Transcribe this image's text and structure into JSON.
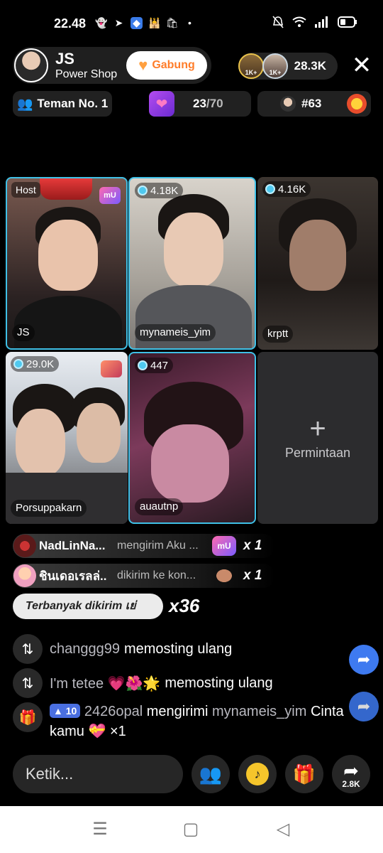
{
  "status_bar": {
    "time": "22.48"
  },
  "header": {
    "host_name": "JS",
    "host_subtitle": "Power Shop",
    "join_label": "Gabung",
    "viewer_badge_1": "1K+",
    "viewer_badge_2": "1K+",
    "viewer_count": "28.3K"
  },
  "chips": {
    "rank_label": "Teman No. 1",
    "slots_current": "23",
    "slots_total": "/70",
    "rank_number": "#63"
  },
  "grid": [
    {
      "label": "Host",
      "name": "JS",
      "sticker": "mU"
    },
    {
      "count": "4.18K",
      "name": "mynameis_yim"
    },
    {
      "count": "4.16K",
      "name": "krptt"
    },
    {
      "count": "29.0K",
      "name": "Porsuppakarn"
    },
    {
      "count": "447",
      "name": "auautnp"
    },
    {
      "request_label": "Permintaan"
    }
  ],
  "gifts": [
    {
      "name": "NadLinNa...",
      "action": "mengirim Aku ...",
      "sticker": "mU",
      "count": "x 1"
    },
    {
      "name": "ชินเดอเรลล่...",
      "action": "dikirim ke kon...",
      "count": "x 1"
    }
  ],
  "top_sender": {
    "label": "Terbanyak dikirim เย่",
    "count": "x36"
  },
  "chat": [
    {
      "user": "changgg99",
      "message": "memosting ulang"
    },
    {
      "user": "I'm tetee 💗🌺🌟",
      "message": "memosting ulang"
    }
  ],
  "gift_message": {
    "level": "10",
    "user": "2426opal",
    "verb": "mengirimi",
    "target": "mynameis_yim",
    "gift": "Cinta",
    "line2": "kamu",
    "count": "×1"
  },
  "bottom": {
    "input_placeholder": "Ketik...",
    "share_count": "2.8K"
  },
  "colors": {
    "accent": "#3fc0e6",
    "join": "#ff7d2a",
    "share": "#3e7af0"
  }
}
